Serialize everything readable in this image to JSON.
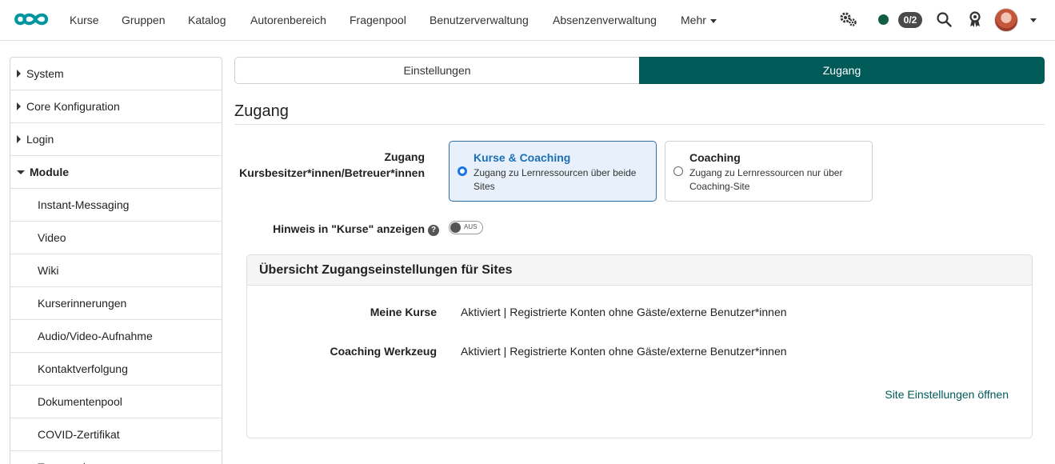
{
  "nav": {
    "items": [
      "Kurse",
      "Gruppen",
      "Katalog",
      "Autorenbereich",
      "Fragenpool",
      "Benutzerverwaltung",
      "Absenzenverwaltung",
      "Mehr"
    ],
    "badge": "0/2",
    "brand_color": "#0096a0"
  },
  "sidebar": {
    "items": [
      {
        "label": "System",
        "level": "top",
        "state": "collapsed"
      },
      {
        "label": "Core Konfiguration",
        "level": "top",
        "state": "collapsed"
      },
      {
        "label": "Login",
        "level": "top",
        "state": "collapsed"
      },
      {
        "label": "Module",
        "level": "top",
        "state": "expanded"
      },
      {
        "label": "Instant-Messaging",
        "level": "sub"
      },
      {
        "label": "Video",
        "level": "sub"
      },
      {
        "label": "Wiki",
        "level": "sub"
      },
      {
        "label": "Kurserinnerungen",
        "level": "sub"
      },
      {
        "label": "Audio/Video-Aufnahme",
        "level": "sub"
      },
      {
        "label": "Kontaktverfolgung",
        "level": "sub"
      },
      {
        "label": "Dokumentenpool",
        "level": "sub"
      },
      {
        "label": "COVID-Zertifikat",
        "level": "sub"
      },
      {
        "label": "Taxonomie",
        "level": "sub"
      }
    ]
  },
  "tabs": {
    "settings": "Einstellungen",
    "access": "Zugang",
    "active_color": "#005a58"
  },
  "main": {
    "title": "Zugang",
    "access_label_line1": "Zugang",
    "access_label_line2": "Kursbesitzer*innen/Betreuer*innen",
    "option1": {
      "title": "Kurse & Coaching",
      "desc": "Zugang zu Lernressourcen über beide Sites",
      "selected": true
    },
    "option2": {
      "title": "Coaching",
      "desc": "Zugang zu Lernressourcen nur über Coaching-Site",
      "selected": false
    },
    "hint_label": "Hinweis in \"Kurse\" anzeigen",
    "toggle_text": "AUS"
  },
  "panel": {
    "title": "Übersicht Zugangseinstellungen für Sites",
    "rows": [
      {
        "label": "Meine Kurse",
        "value": "Aktiviert | Registrierte Konten ohne Gäste/externe Benutzer*innen"
      },
      {
        "label": "Coaching Werkzeug",
        "value": "Aktiviert | Registrierte Konten ohne Gäste/externe Benutzer*innen"
      }
    ],
    "link": "Site Einstellungen öffnen"
  }
}
